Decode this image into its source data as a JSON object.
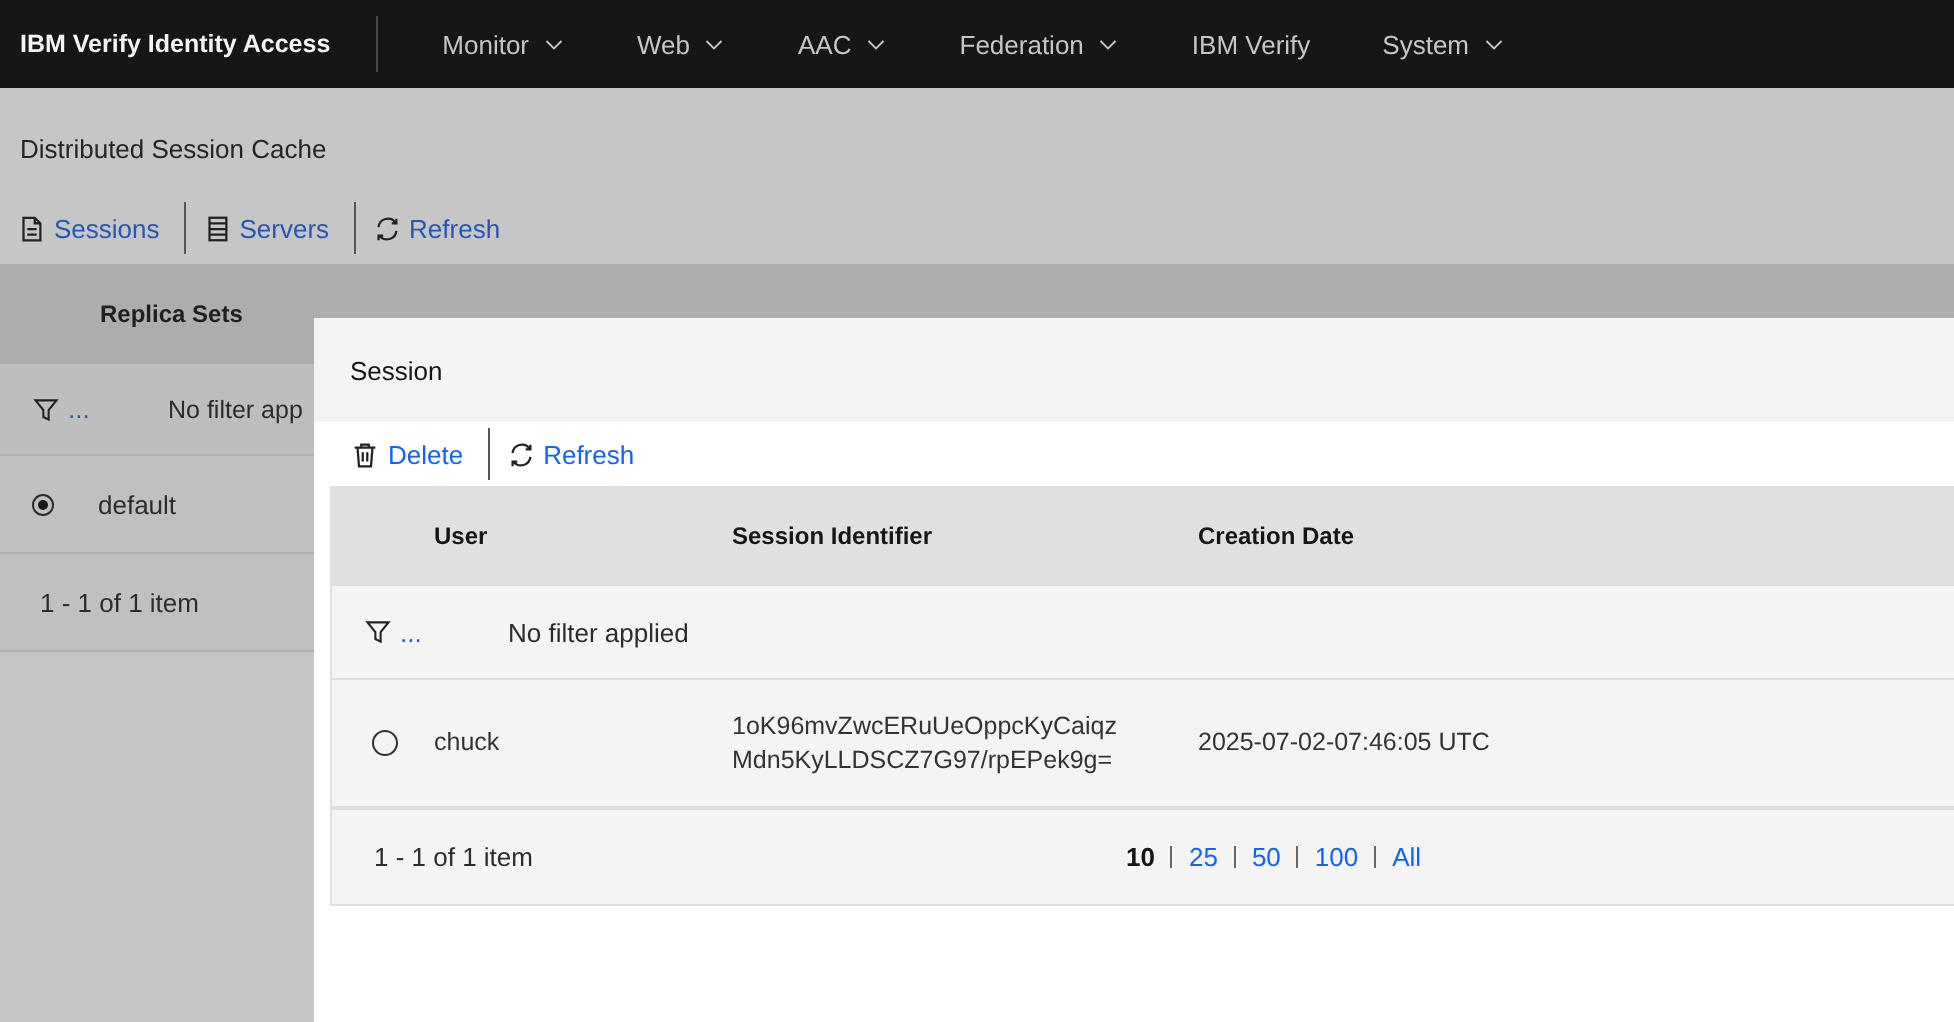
{
  "header": {
    "brand": "IBM Verify Identity Access",
    "menu": [
      {
        "label": "Monitor",
        "dropdown": true
      },
      {
        "label": "Web",
        "dropdown": true
      },
      {
        "label": "AAC",
        "dropdown": true
      },
      {
        "label": "Federation",
        "dropdown": true
      },
      {
        "label": "IBM Verify",
        "dropdown": false
      },
      {
        "label": "System",
        "dropdown": true
      }
    ]
  },
  "page": {
    "title": "Distributed Session Cache",
    "toolbar": [
      {
        "kind": "document",
        "label": "Sessions"
      },
      {
        "kind": "server",
        "label": "Servers"
      },
      {
        "kind": "refresh",
        "label": "Refresh"
      }
    ],
    "replica_table": {
      "columns": [
        "Replica Sets"
      ],
      "filter": {
        "more": "...",
        "text": "No filter app"
      },
      "rows": [
        {
          "name": "default",
          "selected": true
        }
      ],
      "footer": "1 - 1 of 1 item"
    }
  },
  "dialog": {
    "title": "Session",
    "toolbar": [
      {
        "kind": "delete",
        "label": "Delete"
      },
      {
        "kind": "refresh",
        "label": "Refresh"
      }
    ],
    "table": {
      "columns": [
        "User",
        "Session Identifier",
        "Creation Date"
      ],
      "filter": {
        "more": "...",
        "text": "No filter applied"
      },
      "rows": [
        {
          "selected": false,
          "user": "chuck",
          "session_id_lines": [
            "1oK96mvZwcERuUeOppcKyCaiqz",
            "Mdn5KyLLDSCZ7G97/rpEPek9g="
          ],
          "created": "2025-07-02-07:46:05 UTC"
        }
      ],
      "footer": "1 - 1 of 1 item",
      "page_sizes": [
        {
          "label": "10",
          "selected": true
        },
        {
          "label": "25",
          "selected": false
        },
        {
          "label": "50",
          "selected": false
        },
        {
          "label": "100",
          "selected": false
        },
        {
          "label": "All",
          "selected": false
        }
      ]
    }
  }
}
